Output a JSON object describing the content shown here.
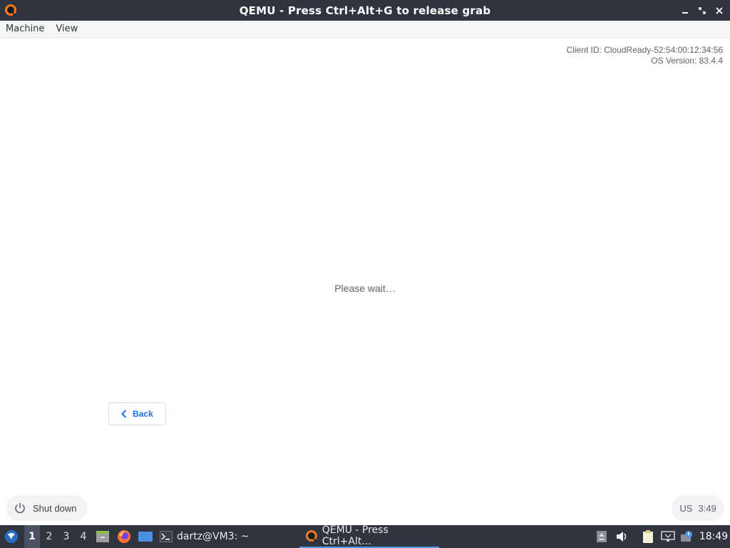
{
  "window": {
    "title": "QEMU - Press Ctrl+Alt+G to release grab",
    "icon": "qemu-icon",
    "controls": [
      "minimize-icon",
      "maximize-icon",
      "close-icon"
    ]
  },
  "menubar": {
    "items": [
      {
        "label": "Machine"
      },
      {
        "label": "View"
      }
    ]
  },
  "vm": {
    "client_id": "Client ID: CloudReady-52:54:00:12:34:56",
    "os_version": "OS Version: 83.4.4",
    "status_text": "Please wait…",
    "back_label": "Back",
    "shutdown_label": "Shut down",
    "keyboard_layout": "US",
    "time": "3:49"
  },
  "taskbar": {
    "workspaces": [
      "1",
      "2",
      "3",
      "4"
    ],
    "active_workspace": "1",
    "tasks": [
      {
        "label": "dartz@VM3: ~",
        "icon": "terminal-icon"
      },
      {
        "label": "QEMU - Press Ctrl+Alt...",
        "icon": "qemu-icon"
      }
    ],
    "clock": "18:49"
  },
  "colors": {
    "titlebar": "#2f343f",
    "accent": "#1a73e8",
    "taskbar_highlight": "#5294e2"
  }
}
